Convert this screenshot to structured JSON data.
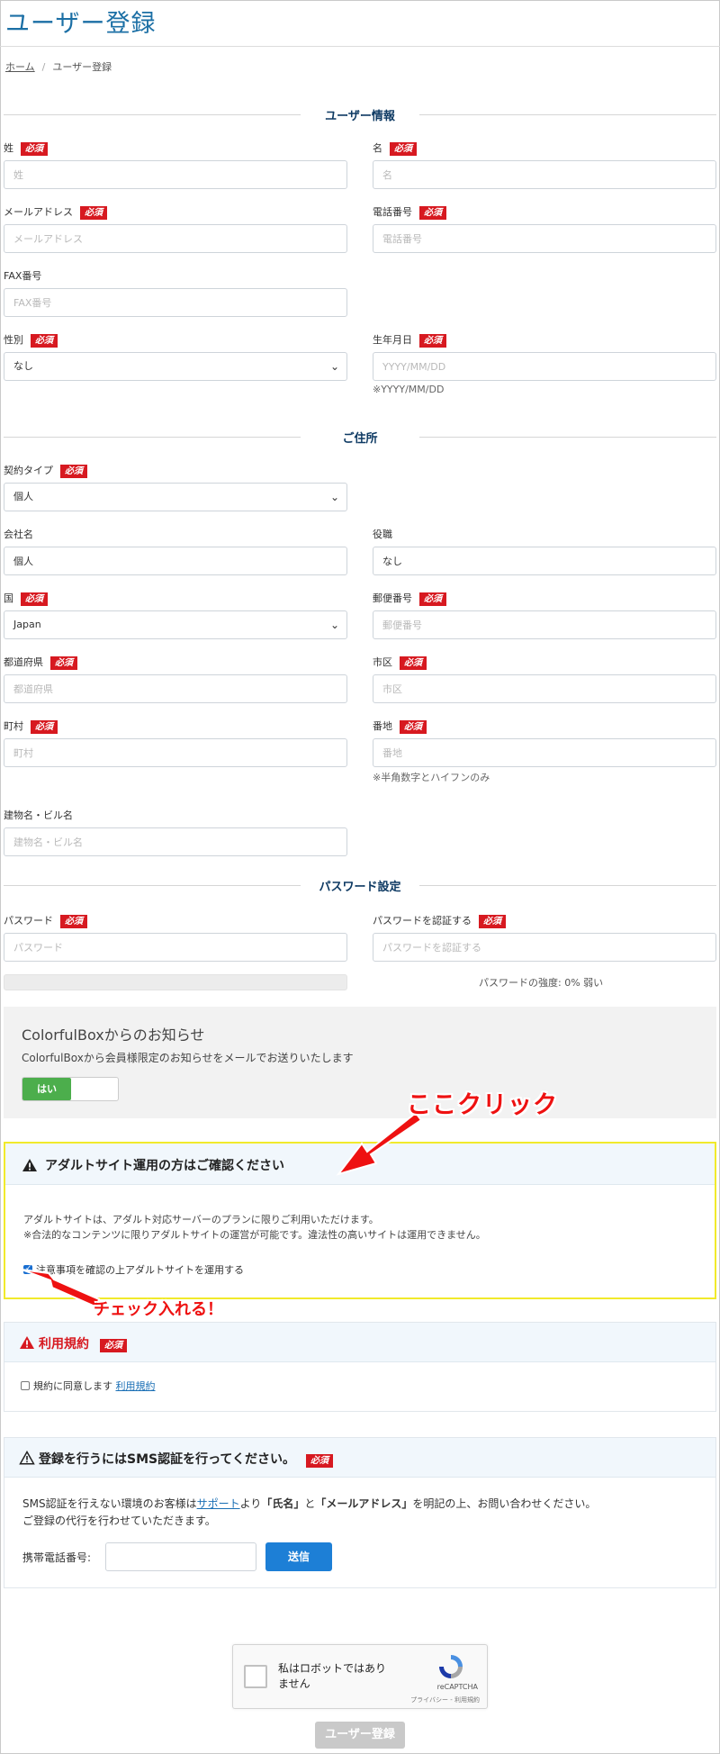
{
  "page_title": "ユーザー登録",
  "breadcrumb": {
    "home": "ホーム",
    "separator": "/",
    "current": "ユーザー登録"
  },
  "required_label": "必須",
  "sections": {
    "user_info": "ユーザー情報",
    "address": "ご住所",
    "password": "パスワード設定"
  },
  "fields": {
    "last_name": {
      "label": "姓",
      "placeholder": "姓"
    },
    "first_name": {
      "label": "名",
      "placeholder": "名"
    },
    "email": {
      "label": "メールアドレス",
      "placeholder": "メールアドレス"
    },
    "phone": {
      "label": "電話番号",
      "placeholder": "電話番号"
    },
    "fax": {
      "label": "FAX番号",
      "placeholder": "FAX番号"
    },
    "gender": {
      "label": "性別",
      "value": "なし"
    },
    "birthdate": {
      "label": "生年月日",
      "placeholder": "YYYY/MM/DD",
      "help": "※YYYY/MM/DD"
    },
    "contract_type": {
      "label": "契約タイプ",
      "value": "個人"
    },
    "company": {
      "label": "会社名",
      "value": "個人"
    },
    "position": {
      "label": "役職",
      "value": "なし"
    },
    "country": {
      "label": "国",
      "value": "Japan"
    },
    "postal": {
      "label": "郵便番号",
      "placeholder": "郵便番号"
    },
    "prefecture": {
      "label": "都道府県",
      "placeholder": "都道府県"
    },
    "city": {
      "label": "市区",
      "placeholder": "市区"
    },
    "town": {
      "label": "町村",
      "placeholder": "町村"
    },
    "street": {
      "label": "番地",
      "placeholder": "番地",
      "help": "※半角数字とハイフンのみ"
    },
    "building": {
      "label": "建物名・ビル名",
      "placeholder": "建物名・ビル名"
    },
    "password": {
      "label": "パスワード",
      "placeholder": "パスワード"
    },
    "password_confirm": {
      "label": "パスワードを認証する",
      "placeholder": "パスワードを認証する"
    }
  },
  "password_strength": {
    "text": "パスワードの強度: 0% 弱い",
    "percent": 0
  },
  "notice": {
    "title": "ColorfulBoxからのお知らせ",
    "text": "ColorfulBoxから会員様限定のお知らせをメールでお送りいたします",
    "toggle_on_label": "はい"
  },
  "annotations": {
    "click_here": "ここクリック",
    "check_here": "チェック入れる！"
  },
  "adult": {
    "title": "アダルトサイト運用の方はご確認ください",
    "line1": "アダルトサイトは、アダルト対応サーバーのプランに限りご利用いただけます。",
    "line2": "※合法的なコンテンツに限りアダルトサイトの運営が可能です。違法性の高いサイトは運用できません。",
    "checkbox_label": "注意事項を確認の上アダルトサイトを運用する",
    "checked": true
  },
  "terms": {
    "title": "利用規約",
    "checkbox_label": "規約に同意します",
    "link": "利用規約",
    "checked": false
  },
  "sms": {
    "title": "登録を行うにはSMS認証を行ってください。",
    "text_pre": "SMS認証を行えない環境のお客様は",
    "support_link": "サポート",
    "text_mid1": "より",
    "bold_name": "「氏名」",
    "text_mid2": "と",
    "bold_email": "「メールアドレス」",
    "text_post": "を明記の上、お問い合わせください。",
    "line2": "ご登録の代行を行わせていただきます。",
    "phone_label": "携帯電話番号:",
    "send_button": "送信"
  },
  "recaptcha": {
    "label": "私はロボットではありません",
    "brand": "reCAPTCHA",
    "legal": "プライバシー - 利用規約"
  },
  "submit_button": "ユーザー登録",
  "colors": {
    "title_blue": "#1b6fa5",
    "required_red": "#d71920",
    "toggle_green": "#4cae4c",
    "send_blue": "#1d7fd6",
    "highlight_yellow": "#f1ea2b",
    "annotation_red": "#ee1111"
  }
}
